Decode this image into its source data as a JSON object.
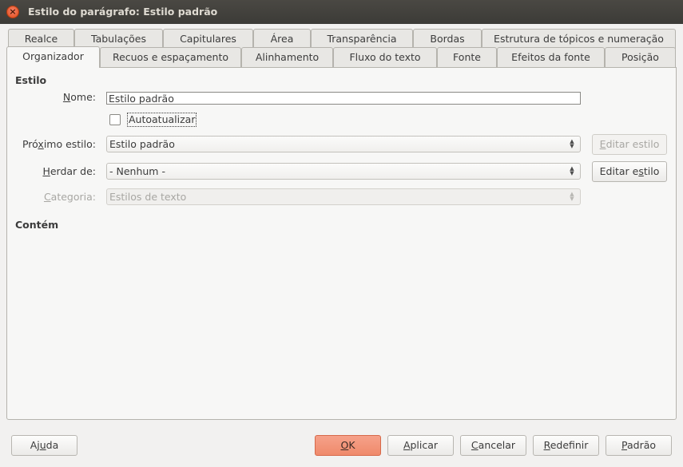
{
  "window": {
    "title": "Estilo do parágrafo: Estilo padrão"
  },
  "tabs_row1": [
    "Realce",
    "Tabulações",
    "Capitulares",
    "Área",
    "Transparência",
    "Bordas",
    "Estrutura de tópicos e numeração"
  ],
  "tabs_row2": [
    "Organizador",
    "Recuos e espaçamento",
    "Alinhamento",
    "Fluxo do texto",
    "Fonte",
    "Efeitos da fonte",
    "Posição"
  ],
  "active_tab": "Organizador",
  "style_section": {
    "title": "Estilo",
    "name_label": "Nome:",
    "name_value": "Estilo padrão",
    "autoupdate_label": "Autoatualizar",
    "autoupdate_checked": false,
    "next_style_label": "Próximo estilo:",
    "next_style_value": "Estilo padrão",
    "edit_style_next": "Editar estilo",
    "inherit_label": "Herdar de:",
    "inherit_value": "- Nenhum -",
    "edit_style_inherit": "Editar estilo",
    "category_label": "Categoria:",
    "category_value": "Estilos de texto"
  },
  "contains_section": {
    "title": "Contém"
  },
  "footer": {
    "help": "Ajuda",
    "ok": "OK",
    "apply": "Aplicar",
    "cancel": "Cancelar",
    "reset": "Redefinir",
    "default": "Padrão"
  },
  "colors": {
    "primary_button": "#ef8a6b",
    "titlebar": "#3c3b37",
    "close": "#df4a16"
  },
  "icons": {
    "close": "close-icon",
    "spin": "up-down-spin-icon"
  }
}
